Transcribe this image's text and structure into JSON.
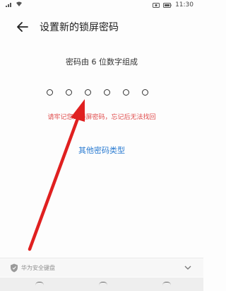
{
  "status_bar": {
    "left_icons": [
      "signal-icon",
      "wifi-icon"
    ],
    "right_icons": [
      "camera-icon",
      "battery-icon"
    ],
    "time": "11:30"
  },
  "header": {
    "back_icon": "back-arrow-icon",
    "title": "设置新的锁屏密码"
  },
  "prompt": {
    "hint": "密码由 6 位数字组成",
    "dot_count": 6,
    "warning": "请牢记您的锁屏密码，忘记后无法找回",
    "other_types_link": "其他密码类型"
  },
  "keyboard_bar": {
    "shield_icon": "shield-icon",
    "label": "华为安全键盘",
    "collapse_icon": "chevron-down-icon"
  },
  "colors": {
    "warning": "#e04b4b",
    "link": "#2a7bd1",
    "annotation_arrow": "#e02020"
  }
}
